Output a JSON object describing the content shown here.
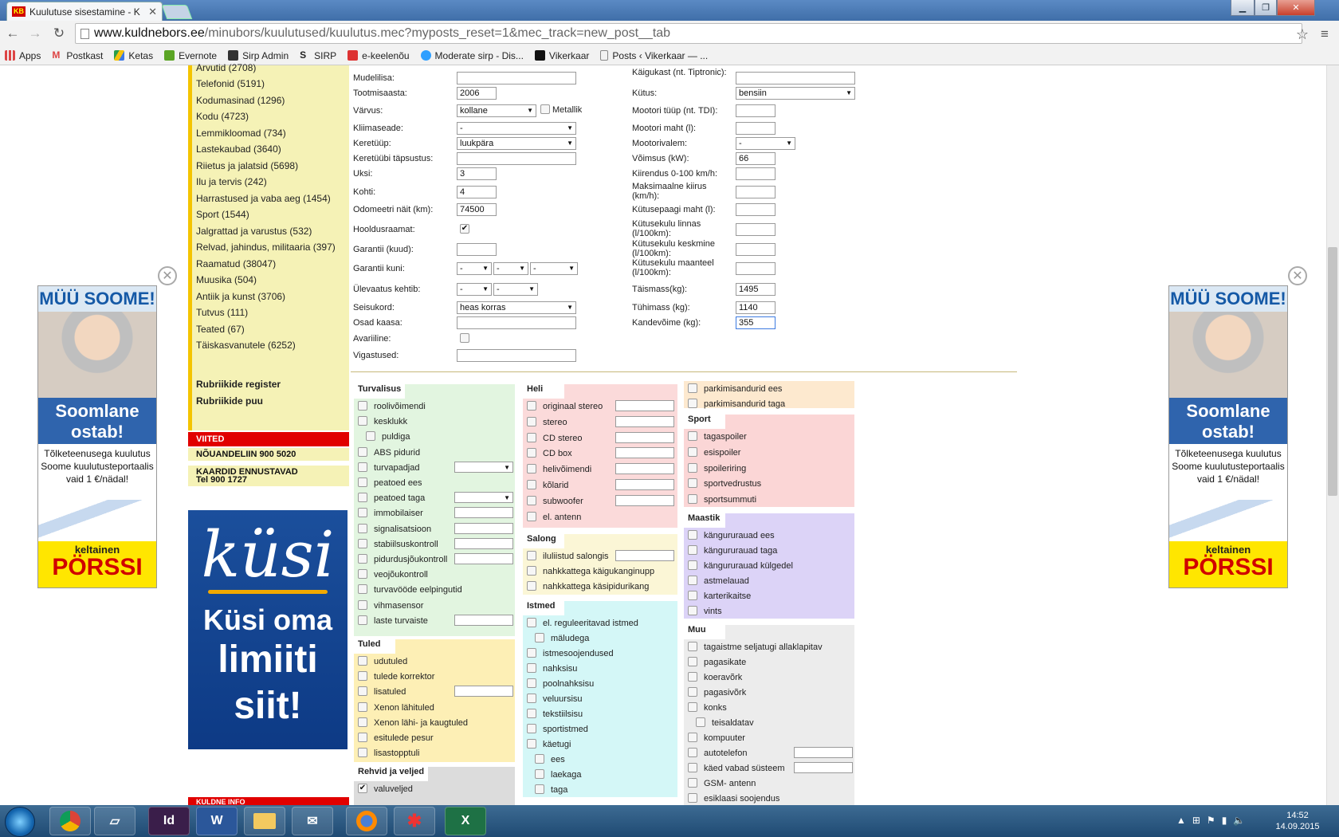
{
  "browser": {
    "tab_title": "Kuulutuse sisestamine - K",
    "tab_favicon": "KB",
    "url_domain": "www.kuldnebors.ee",
    "url_path": "/minubors/kuulutused/kuulutus.mec?myposts_reset=1&mec_track=new_post__tab",
    "bookmarks": [
      "Apps",
      "Postkast",
      "Ketas",
      "Evernote",
      "Sirp Admin",
      "SIRP",
      "e-keelenõu",
      "Moderate sirp - Dis...",
      "Vikerkaar",
      "Posts ‹ Vikerkaar — ..."
    ]
  },
  "sidebar": {
    "categories": [
      "Arvutid (2708)",
      "Telefonid (5191)",
      "Kodumasinad (1296)",
      "Kodu (4723)",
      "Lemmikloomad (734)",
      "Lastekaubad (3640)",
      "Riietus ja jalatsid (5698)",
      "Ilu ja tervis (242)",
      "Harrastused ja vaba aeg (1454)",
      "Sport (1544)",
      "Jalgrattad ja varustus (532)",
      "Relvad, jahindus, militaaria (397)",
      "Raamatud (38047)",
      "Muusika (504)",
      "Antiik ja kunst (3706)",
      "Tutvus (111)",
      "Teated (67)",
      "Täiskasvanutele (6252)"
    ],
    "links": [
      "Rubriikide register",
      "Rubriikide puu"
    ],
    "viited_title": "VIITED",
    "viited": [
      "NÕUANDELIIN 900 5020",
      "KAARDID ENNUSTAVAD",
      "Tel 900 1727"
    ],
    "kuldne_title": "KULDNE INFO"
  },
  "ad_kusi": {
    "logo": "küsi",
    "line1": "Küsi oma",
    "line2": "limiiti",
    "line3": "siit!"
  },
  "ad_soome": {
    "head": "MÜÜ SOOME!",
    "blue1": "Soomlane",
    "blue2": "ostab!",
    "body1": "Tõlketeenusega kuulutus",
    "body2": "Soome kuulutusteportaalis",
    "body3": "vaid 1 €/nädal!",
    "brand1": "keltainen",
    "brand2": "PÖRSSI",
    "close": "✕"
  },
  "form_left": [
    {
      "label": "Mudelilisa:",
      "type": "text",
      "value": ""
    },
    {
      "label": "Tootmisaasta:",
      "type": "text",
      "value": "2006"
    },
    {
      "label": "Värvus:",
      "type": "select",
      "value": "kollane",
      "extra": "Metallik"
    },
    {
      "label": "Kliimaseade:",
      "type": "select",
      "value": "-"
    },
    {
      "label": "Keretüüp:",
      "type": "select",
      "value": "luukpära"
    },
    {
      "label": "Keretüübi täpsustus:",
      "type": "text",
      "value": ""
    },
    {
      "label": "Uksi:",
      "type": "text",
      "value": "3"
    },
    {
      "label": "Kohti:",
      "type": "text",
      "value": "4"
    },
    {
      "label": "Odomeetri näit (km):",
      "type": "text",
      "value": "74500"
    },
    {
      "label": "Hooldusraamat:",
      "type": "check",
      "value": "✔"
    },
    {
      "label": "Garantii (kuud):",
      "type": "text",
      "value": ""
    },
    {
      "label": "Garantii kuni:",
      "type": "select3",
      "value": "-"
    },
    {
      "label": "Ülevaatus kehtib:",
      "type": "select2",
      "value": "-"
    },
    {
      "label": "Seisukord:",
      "type": "select",
      "value": "heas korras"
    },
    {
      "label": "Osad kaasa:",
      "type": "text",
      "value": ""
    },
    {
      "label": "Avariiline:",
      "type": "check",
      "value": ""
    },
    {
      "label": "Vigastused:",
      "type": "text",
      "value": ""
    }
  ],
  "form_right": [
    {
      "label": "Käigukast (nt. Tiptronic):",
      "type": "text",
      "value": ""
    },
    {
      "label": "Kütus:",
      "type": "select",
      "value": "bensiin"
    },
    {
      "label": "Mootori tüüp (nt. TDI):",
      "type": "text",
      "value": ""
    },
    {
      "label": "Mootori maht (l):",
      "type": "text",
      "value": ""
    },
    {
      "label": "Mootorivalem:",
      "type": "select",
      "value": "-"
    },
    {
      "label": "Võimsus (kW):",
      "type": "text",
      "value": "66"
    },
    {
      "label": "Kiirendus 0-100 km/h:",
      "type": "text",
      "value": ""
    },
    {
      "label": "Maksimaalne kiirus (km/h):",
      "type": "text",
      "value": ""
    },
    {
      "label": "Kütusepaagi maht (l):",
      "type": "text",
      "value": ""
    },
    {
      "label": "Kütusekulu linnas (l/100km):",
      "type": "text",
      "value": ""
    },
    {
      "label": "Kütusekulu keskmine (l/100km):",
      "type": "text",
      "value": ""
    },
    {
      "label": "Kütusekulu maanteel (l/100km):",
      "type": "text",
      "value": ""
    },
    {
      "label": "Täismass(kg):",
      "type": "text",
      "value": "1495"
    },
    {
      "label": "Tühimass (kg):",
      "type": "text",
      "value": "1140"
    },
    {
      "label": "Kandevõime (kg):",
      "type": "text",
      "value": "355"
    }
  ],
  "features": {
    "turvalisus": {
      "title": "Turvalisus",
      "color": "#e2f5e0",
      "items": [
        "roolivõimendi",
        "kesklukk",
        "puldiga",
        "ABS pidurid",
        "turvapadjad",
        "peatoed ees",
        "peatoed taga",
        "immobilaiser",
        "signalisatsioon",
        "stabiilsuskontroll",
        "pidurdusjõukontroll",
        "veojõukontroll",
        "turvavööde eelpingutid",
        "vihmasensor",
        "laste turvaiste"
      ]
    },
    "tuled": {
      "title": "Tuled",
      "color": "#fdefb5",
      "items": [
        "udutuled",
        "tulede korrektor",
        "lisatuled",
        "Xenon lähituled",
        "Xenon lähi- ja kaugtuled",
        "esitulede pesur",
        "lisastopptuli"
      ]
    },
    "rehvid": {
      "title": "Rehvid ja veljed",
      "color": "#dcdcdc",
      "items": [
        "valuveljed"
      ]
    },
    "heli": {
      "title": "Heli",
      "color": "#fbdada",
      "items": [
        "originaal stereo",
        "stereo",
        "CD stereo",
        "CD box",
        "helivõimendi",
        "kõlarid",
        "subwoofer",
        "el. antenn"
      ]
    },
    "salong": {
      "title": "Salong",
      "color": "#fbf6d6",
      "items": [
        "iluliistud salongis",
        "nahkkattega käigukanginupp",
        "nahkkattega käsipidurikang"
      ]
    },
    "istmed": {
      "title": "Istmed",
      "color": "#d4f7f7",
      "items": [
        "el. reguleeritavad istmed",
        "mäludega",
        "istmesoojendused",
        "nahksisu",
        "poolnahksisu",
        "veluursisu",
        "tekstiilsisu",
        "sportistmed",
        "käetugi",
        "ees",
        "laekaga",
        "taga"
      ]
    },
    "parkimine": {
      "title": "",
      "color": "#fde9cf",
      "items": [
        "parkimisandurid ees",
        "parkimisandurid taga"
      ]
    },
    "sport": {
      "title": "Sport",
      "color": "#fbd6d6",
      "items": [
        "tagaspoiler",
        "esispoiler",
        "spoileriring",
        "sportvedrustus",
        "sportsummuti"
      ]
    },
    "maastik": {
      "title": "Maastik",
      "color": "#dcd3f7",
      "items": [
        "kängururauad ees",
        "kängururauad taga",
        "kängururauad külgedel",
        "astmelauad",
        "karterikaitse",
        "vints"
      ]
    },
    "muu": {
      "title": "Muu",
      "color": "#ececec",
      "items": [
        "tagaistme seljatugi allaklapitav",
        "pagasikate",
        "koeravõrk",
        "pagasivõrk",
        "konks",
        "teisaldatav",
        "kompuuter",
        "autotelefon",
        "käed vabad süsteem",
        "GSM- antenn",
        "esiklaasi soojendus"
      ]
    }
  },
  "taskbar": {
    "clock_time": "14:52",
    "clock_date": "14.09.2015"
  }
}
